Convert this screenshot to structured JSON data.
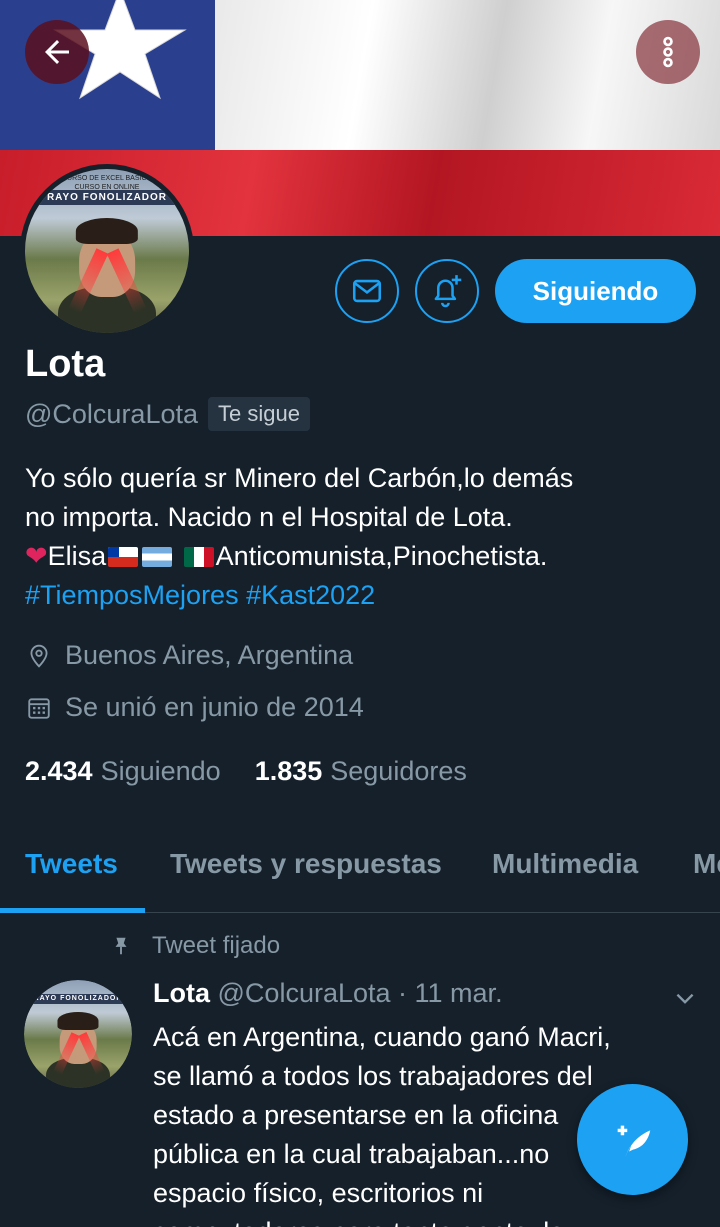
{
  "header": {
    "back_icon": "arrow-left-icon",
    "more_icon": "more-vertical-icon"
  },
  "avatar": {
    "caption": "RAYO FONOLIZADOR",
    "top_text": "CURSO DE EXCEL BASICO CURSO EN ONLINE"
  },
  "actions": {
    "message_icon": "mail-icon",
    "notification_icon": "bell-plus-icon",
    "follow_label": "Siguiendo"
  },
  "profile": {
    "name": "Lota",
    "handle": "@ColcuraLota",
    "follows_you": "Te sigue",
    "bio": {
      "line1": "Yo sólo quería sr Minero del Carbón,lo demás",
      "line2": "no importa. Nacido n el Hospital de Lota.",
      "line3_name": "Elisa",
      "line3_text": "Anticomunista,Pinochetista.",
      "hashtag1": "#TiemposMejores",
      "hashtag2": "#Kast2022"
    },
    "location": "Buenos Aires, Argentina",
    "joined": "Se unió en junio de 2014",
    "following_count": "2.434",
    "following_label": "Siguiendo",
    "followers_count": "1.835",
    "followers_label": "Seguidores"
  },
  "tabs": [
    {
      "label": "Tweets"
    },
    {
      "label": "Tweets y respuestas"
    },
    {
      "label": "Multimedia"
    },
    {
      "label": "Me"
    }
  ],
  "pinned_tweet": {
    "pinned_label": "Tweet fijado",
    "author_name": "Lota",
    "author_handle": "@ColcuraLota",
    "date": "· 11 mar.",
    "lines": [
      "Acá en Argentina, cuando ganó Macri,",
      "se llamó a todos los trabajadores del",
      "estado a presentarse en la oficina",
      "pública en la cual trabajaban...no",
      "espacio físico, escritorios ni",
      "computadoras para tanta gente, la"
    ]
  },
  "colors": {
    "background": "#15202b",
    "accent": "#1da1f2",
    "secondary_text": "#8899a6"
  }
}
